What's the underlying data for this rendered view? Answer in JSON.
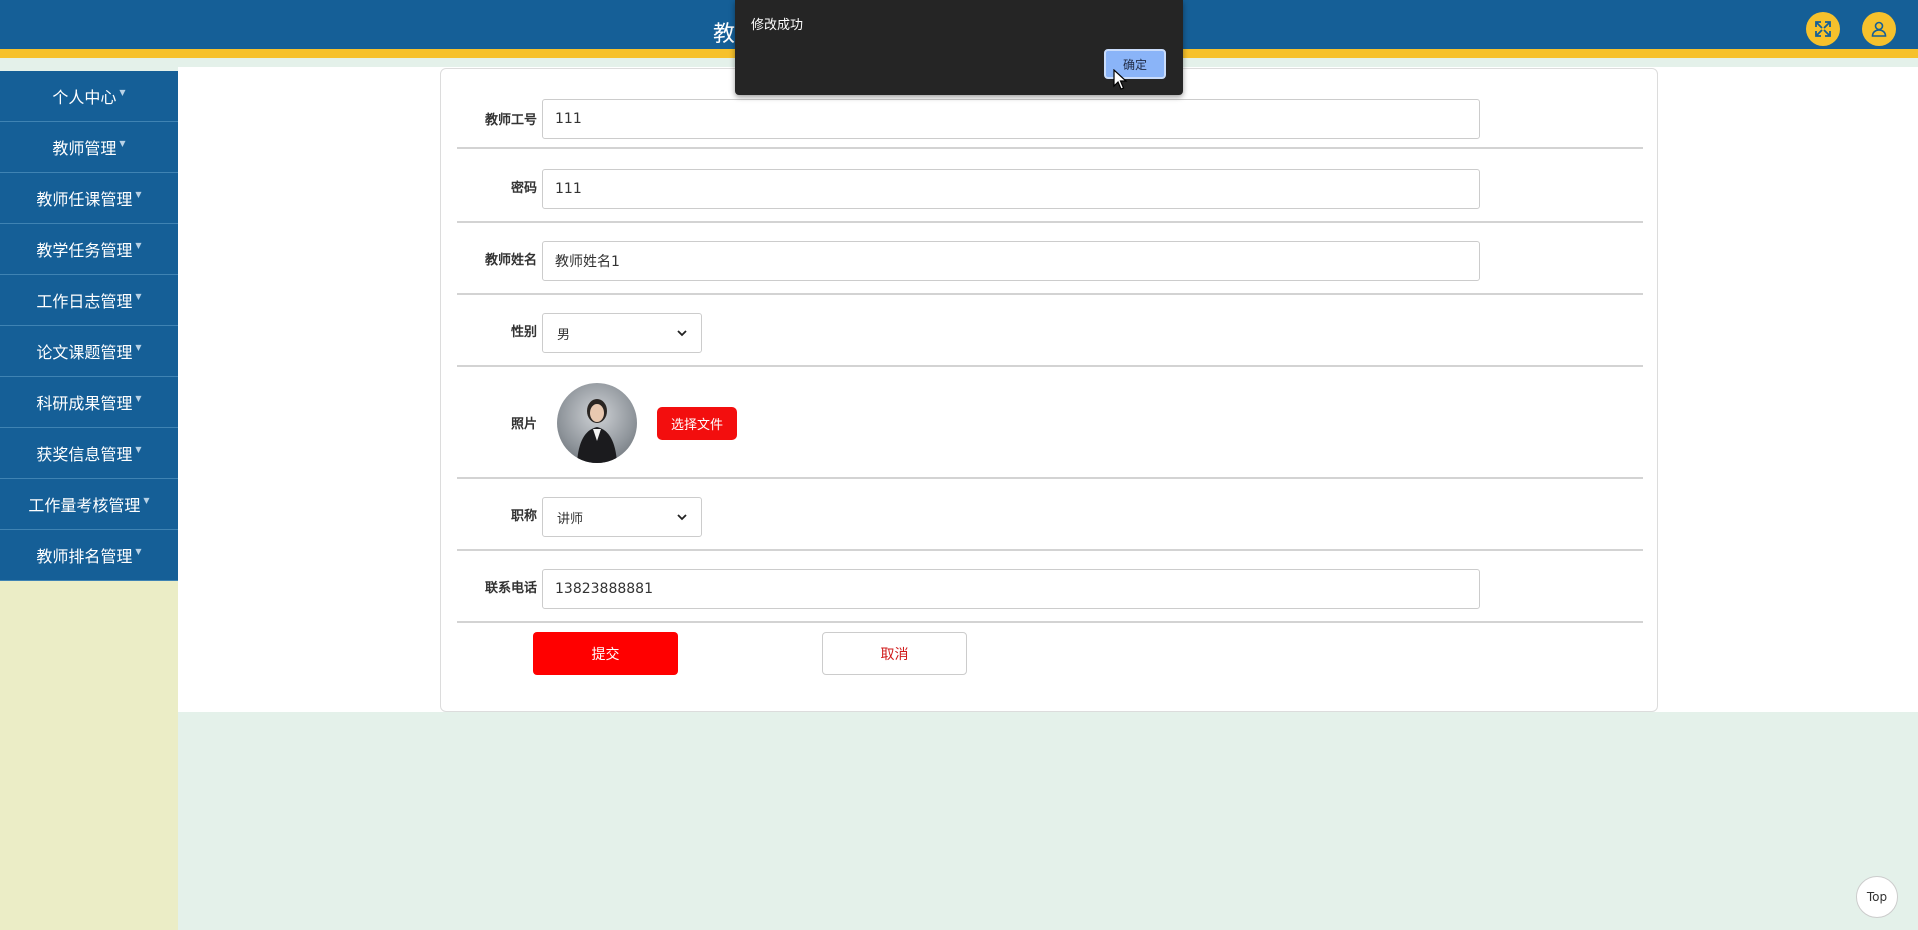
{
  "header": {
    "title_fragment": "教"
  },
  "sidebar": {
    "items": [
      {
        "label": "个人中心"
      },
      {
        "label": "教师管理"
      },
      {
        "label": "教师任课管理"
      },
      {
        "label": "教学任务管理"
      },
      {
        "label": "工作日志管理"
      },
      {
        "label": "论文课题管理"
      },
      {
        "label": "科研成果管理"
      },
      {
        "label": "获奖信息管理"
      },
      {
        "label": "工作量考核管理"
      },
      {
        "label": "教师排名管理"
      }
    ]
  },
  "form": {
    "teacher_id": {
      "label": "教师工号",
      "value": "111"
    },
    "password": {
      "label": "密码",
      "value": "111"
    },
    "teacher_name": {
      "label": "教师姓名",
      "value": "教师姓名1"
    },
    "gender": {
      "label": "性别",
      "value": "男"
    },
    "photo": {
      "label": "照片",
      "button": "选择文件"
    },
    "title": {
      "label": "职称",
      "value": "讲师"
    },
    "phone": {
      "label": "联系电话",
      "value": "13823888881"
    },
    "submit_label": "提交",
    "cancel_label": "取消"
  },
  "dialog": {
    "message": "修改成功",
    "ok_label": "确定"
  },
  "back_to_top": "Top"
}
